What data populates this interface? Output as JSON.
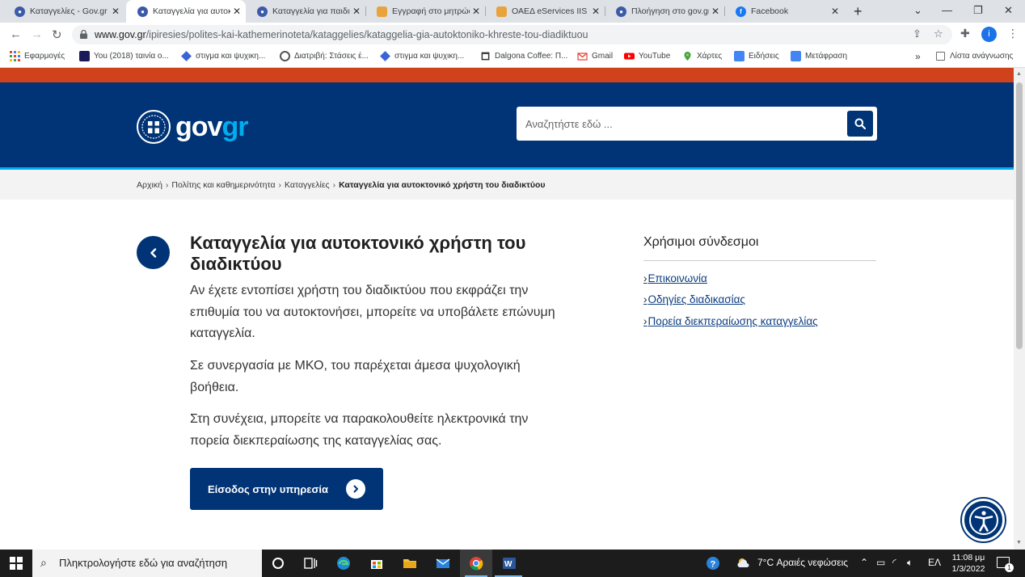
{
  "browser": {
    "tabs": [
      {
        "label": "Καταγγελίες - Gov.gr",
        "color": "#3b5ba9"
      },
      {
        "label": "Καταγγελία για αυτοκτονικό",
        "color": "#3b5ba9",
        "active": true
      },
      {
        "label": "Καταγγελία για παιδική",
        "color": "#3b5ba9"
      },
      {
        "label": "Εγγραφή στο μητρώο",
        "color": "#e8a33c"
      },
      {
        "label": "ΟΑΕΔ eServices IIS",
        "color": "#e8a33c"
      },
      {
        "label": "Πλοήγηση στο gov.gr",
        "color": "#3b5ba9"
      },
      {
        "label": "Facebook",
        "color": "#1877f2"
      }
    ],
    "url_host": "www.gov.gr",
    "url_path": "/ipiresies/polites-kai-kathemerinoteta/kataggelies/kataggelia-gia-autoktoniko-khreste-tou-diadiktuou",
    "profile_initial": "i",
    "bookmarks": [
      {
        "label": "Εφαρμογές",
        "icon": "apps-icon"
      },
      {
        "label": "You (2018) ταινία ο...",
        "icon": "clapper-icon"
      },
      {
        "label": "στιγμα και ψυχικη...",
        "icon": "diamond-icon"
      },
      {
        "label": "Διατριβή: Στάσεις έ...",
        "icon": "globe-icon"
      },
      {
        "label": "στιγμα και ψυχικη...",
        "icon": "diamond-icon"
      },
      {
        "label": "Dalgona Coffee: Π...",
        "icon": "trash-icon"
      },
      {
        "label": "Gmail",
        "icon": "gmail-icon"
      },
      {
        "label": "YouTube",
        "icon": "youtube-icon"
      },
      {
        "label": "Χάρτες",
        "icon": "maps-icon"
      },
      {
        "label": "Ειδήσεις",
        "icon": "news-icon"
      },
      {
        "label": "Μετάφραση",
        "icon": "translate-icon"
      }
    ],
    "more_bookmarks": "»",
    "reading_list": "Λίστα ανάγνωσης"
  },
  "site": {
    "logo_gov": "gov",
    "logo_gr": "gr",
    "search_placeholder": "Αναζητήστε εδώ ...",
    "breadcrumb": [
      "Αρχική",
      "Πολίτης και καθημερινότητα",
      "Καταγγελίες",
      "Καταγγελία για αυτοκτονικό χρήστη του διαδικτύου"
    ],
    "title": "Καταγγελία για αυτοκτονικό χρήστη του διαδικτύου",
    "paragraphs": [
      "Αν έχετε εντοπίσει χρήστη του διαδικτύου που εκφράζει την επιθυμία του να αυτοκτονήσει, μπορείτε να υποβάλετε επώνυμη καταγγελία.",
      "Σε συνεργασία με ΜΚΟ, του παρέχεται άμεσα ψυχολογική βοήθεια.",
      "Στη συνέχεια, μπορείτε να παρακολουθείτε ηλεκτρονικά την πορεία διεκπεραίωσης της καταγγελίας σας."
    ],
    "cta_label": "Είσοδος στην υπηρεσία",
    "useful_links_title": "Χρήσιμοι σύνδεσμοι",
    "useful_links": [
      "Επικοινωνία",
      "Οδηγίες διαδικασίας",
      "Πορεία διεκπεραίωσης καταγγελίας"
    ],
    "colors": {
      "navy": "#003476",
      "accent": "#00aeef",
      "red": "#d0421c"
    }
  },
  "taskbar": {
    "search_text": "Πληκτρολογήστε εδώ για αναζήτηση",
    "weather": "7°C  Αραιές νεφώσεις",
    "language": "ΕΛ",
    "time": "11:08 μμ",
    "date": "1/3/2022",
    "notifications": "1"
  }
}
